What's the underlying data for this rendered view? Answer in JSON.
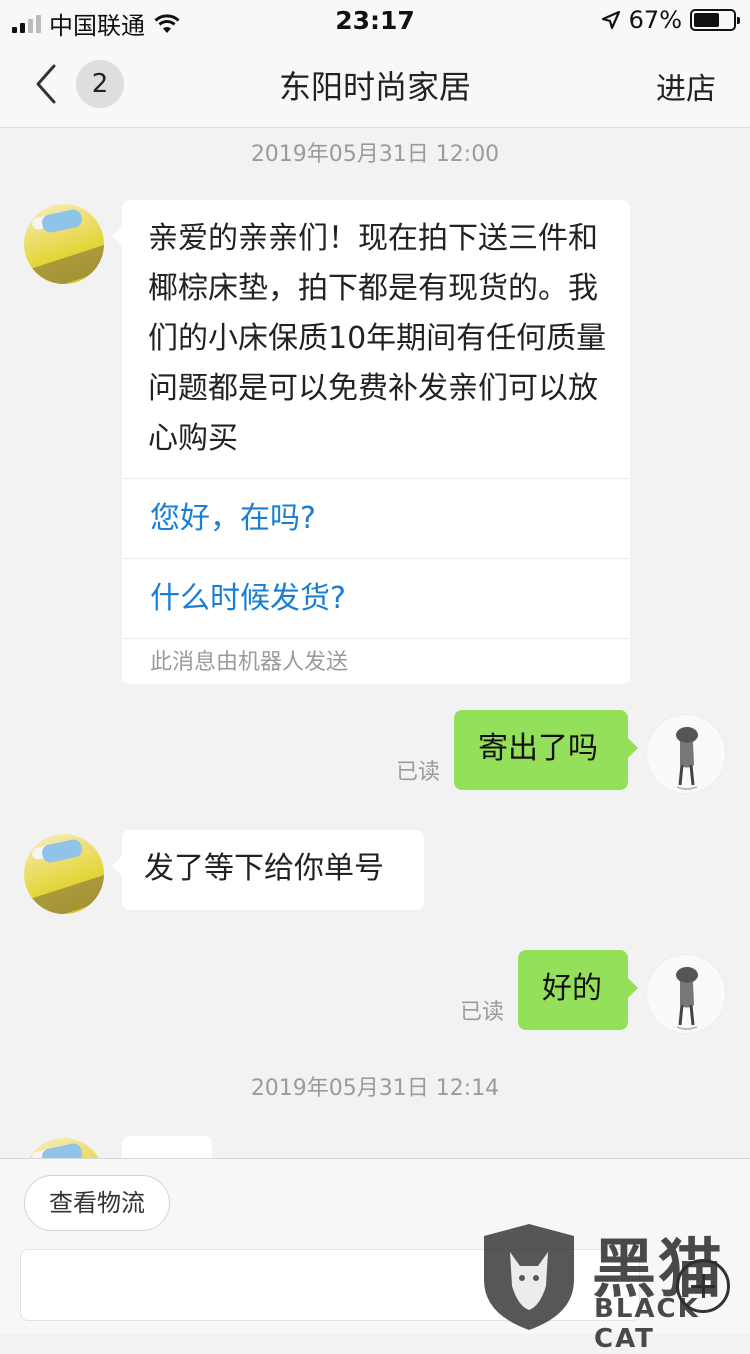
{
  "status_bar": {
    "carrier": "中国联通",
    "time": "23:17",
    "battery_percent": "67%",
    "battery_level": 0.67,
    "icons": [
      "signal-icon",
      "wifi-icon",
      "location-arrow-icon",
      "battery-icon"
    ]
  },
  "nav": {
    "back_icon": "chevron-left-icon",
    "unread_count": "2",
    "title": "东阳时尚家居",
    "action": "进店"
  },
  "chat": {
    "timestamps": [
      "2019年05月31日 12:00",
      "2019年05月31日 12:14"
    ],
    "bot_message": {
      "text": "亲爱的亲亲们！现在拍下送三件和椰棕床垫，拍下都是有现货的。我们的小床保质10年期间有任何质量问题都是可以免费补发亲们可以放心购买",
      "quick_replies": [
        "您好，在吗?",
        "什么时候发货?"
      ],
      "footer": "此消息由机器人发送"
    },
    "messages": [
      {
        "side": "out",
        "text": "寄出了吗",
        "status": "已读"
      },
      {
        "side": "in",
        "text": "发了等下给你单号"
      },
      {
        "side": "out",
        "text": "好的",
        "status": "已读"
      }
    ]
  },
  "bottom": {
    "chip_label": "查看物流",
    "input_placeholder": "",
    "plus_icon": "plus-circle-icon"
  },
  "watermark": {
    "cn_text": "黑猫",
    "en_text": "BLACK CAT"
  },
  "colors": {
    "outgoing_bubble": "#94e05a",
    "link_blue": "#1a7fd4",
    "background": "#f2f2f2"
  }
}
